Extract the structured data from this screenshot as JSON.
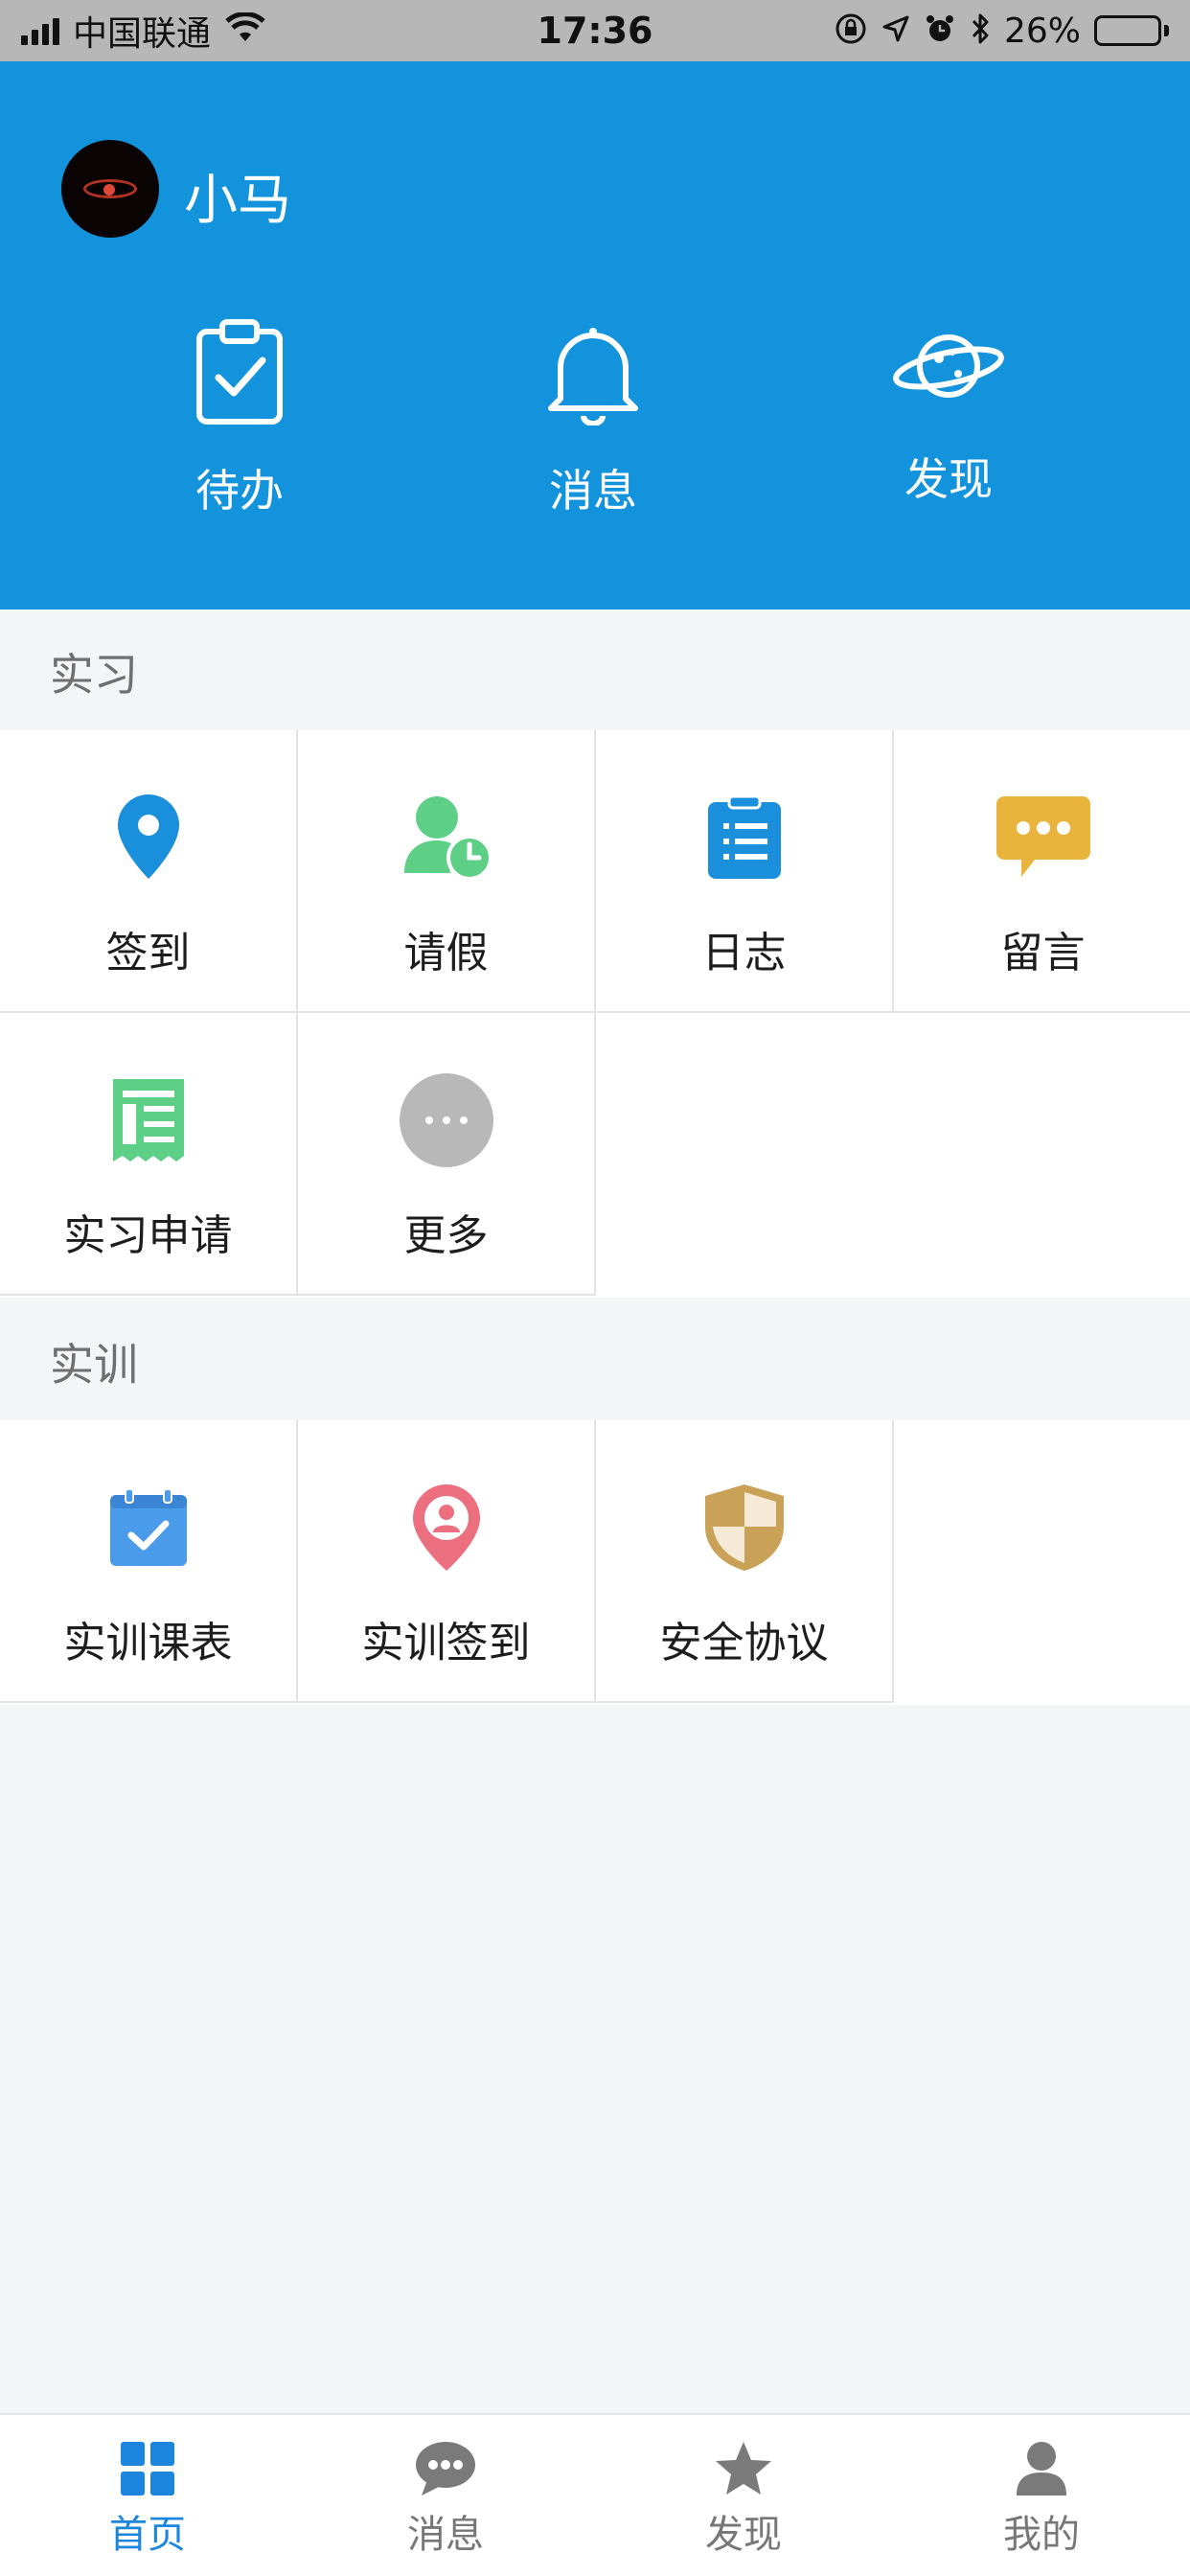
{
  "status_bar": {
    "carrier": "中国联通",
    "time": "17:36",
    "battery_percent": "26%",
    "battery_level": 0.26,
    "icons": [
      "signal-icon",
      "wifi-icon",
      "rotation-lock-icon",
      "location-arrow-icon",
      "alarm-icon",
      "bluetooth-icon",
      "battery-icon"
    ]
  },
  "header": {
    "username": "小马",
    "background_color": "#1493dd",
    "quick_actions": [
      {
        "label": "待办",
        "icon": "clipboard-check-icon"
      },
      {
        "label": "消息",
        "icon": "bell-icon"
      },
      {
        "label": "发现",
        "icon": "planet-icon"
      }
    ]
  },
  "sections": [
    {
      "title": "实习",
      "items": [
        {
          "label": "签到",
          "icon": "location-pin-icon",
          "color": "#1a8fdc"
        },
        {
          "label": "请假",
          "icon": "user-clock-icon",
          "color": "#5ecf86"
        },
        {
          "label": "日志",
          "icon": "notebook-list-icon",
          "color": "#1a8fdc"
        },
        {
          "label": "留言",
          "icon": "chat-bubble-icon",
          "color": "#e9b43c"
        },
        {
          "label": "实习申请",
          "icon": "form-document-icon",
          "color": "#5ecf86"
        },
        {
          "label": "更多",
          "icon": "more-icon",
          "color": "#b8b8b8"
        }
      ]
    },
    {
      "title": "实训",
      "items": [
        {
          "label": "实训课表",
          "icon": "calendar-check-icon",
          "color": "#4a9bea"
        },
        {
          "label": "实训签到",
          "icon": "person-pin-icon",
          "color": "#ec6f7f"
        },
        {
          "label": "安全协议",
          "icon": "shield-icon",
          "color": "#c9a157"
        }
      ]
    }
  ],
  "tab_bar": {
    "active_color": "#1c86de",
    "inactive_color": "#777777",
    "tabs": [
      {
        "label": "首页",
        "icon": "grid-home-icon",
        "active": true
      },
      {
        "label": "消息",
        "icon": "chat-icon",
        "active": false
      },
      {
        "label": "发现",
        "icon": "star-icon",
        "active": false
      },
      {
        "label": "我的",
        "icon": "user-icon",
        "active": false
      }
    ]
  }
}
